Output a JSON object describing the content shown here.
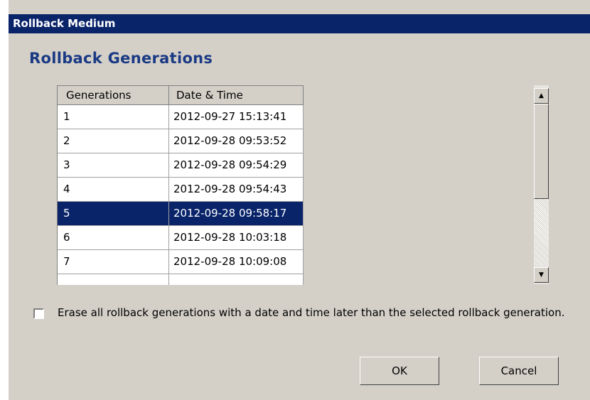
{
  "window": {
    "title": "Rollback Medium"
  },
  "section": {
    "heading": "Rollback Generations"
  },
  "table": {
    "columns": [
      "Generations",
      "Date & Time"
    ],
    "rows": [
      {
        "generation": "1",
        "datetime": "2012-09-27 15:13:41",
        "selected": false
      },
      {
        "generation": "2",
        "datetime": "2012-09-28 09:53:52",
        "selected": false
      },
      {
        "generation": "3",
        "datetime": "2012-09-28 09:54:29",
        "selected": false
      },
      {
        "generation": "4",
        "datetime": "2012-09-28 09:54:43",
        "selected": false
      },
      {
        "generation": "5",
        "datetime": "2012-09-28 09:58:17",
        "selected": true
      },
      {
        "generation": "6",
        "datetime": "2012-09-28 10:03:18",
        "selected": false
      },
      {
        "generation": "7",
        "datetime": "2012-09-28 10:09:08",
        "selected": false
      }
    ]
  },
  "scrollbar": {
    "up_glyph": "▲",
    "down_glyph": "▼"
  },
  "options": {
    "erase_later_label": "Erase all rollback generations with a date and time later than the selected rollback generation.",
    "erase_later_checked": false
  },
  "buttons": {
    "ok_label": "OK",
    "cancel_label": "Cancel"
  },
  "colors": {
    "title_bar": "#0a246a",
    "heading": "#1a3a84",
    "selection": "#0a246a",
    "dialog_bg": "#d4d0c8"
  }
}
